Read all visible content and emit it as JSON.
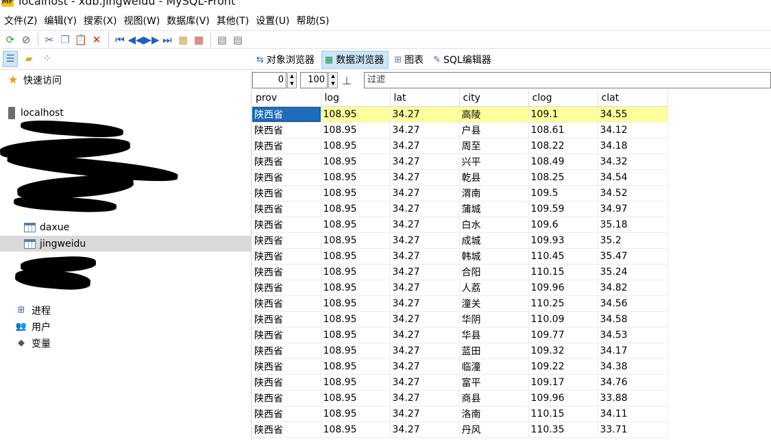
{
  "window": {
    "logo": "MF",
    "title": "localhost - xdb.jingweidu - MySQL-Front"
  },
  "menu": [
    "文件(Z)",
    "编辑(Y)",
    "搜索(X)",
    "视图(W)",
    "数据库(V)",
    "其他(T)",
    "设置(U)",
    "帮助(S)"
  ],
  "views": {
    "object_browser": "对象浏览器",
    "data_browser": "数据浏览器",
    "diagram": "图表",
    "sql_editor": "SQL编辑器"
  },
  "tree": {
    "quick_access": "快速访问",
    "host": "localhost",
    "tables": [
      "daxue",
      "jingweidu"
    ],
    "processes": "进程",
    "users": "用户",
    "variables": "变量"
  },
  "filter": {
    "offset": "0",
    "limit": "100",
    "placeholder": "过滤"
  },
  "grid": {
    "columns": [
      "prov",
      "log",
      "lat",
      "city",
      "clog",
      "clat"
    ],
    "rows": [
      [
        "陕西省",
        "108.95",
        "34.27",
        "高陵",
        "109.1",
        "34.55"
      ],
      [
        "陕西省",
        "108.95",
        "34.27",
        "户县",
        "108.61",
        "34.12"
      ],
      [
        "陕西省",
        "108.95",
        "34.27",
        "周至",
        "108.22",
        "34.18"
      ],
      [
        "陕西省",
        "108.95",
        "34.27",
        "兴平",
        "108.49",
        "34.32"
      ],
      [
        "陕西省",
        "108.95",
        "34.27",
        "乾县",
        "108.25",
        "34.54"
      ],
      [
        "陕西省",
        "108.95",
        "34.27",
        "渭南",
        "109.5",
        "34.52"
      ],
      [
        "陕西省",
        "108.95",
        "34.27",
        "蒲城",
        "109.59",
        "34.97"
      ],
      [
        "陕西省",
        "108.95",
        "34.27",
        "白水",
        "109.6",
        "35.18"
      ],
      [
        "陕西省",
        "108.95",
        "34.27",
        "成城",
        "109.93",
        "35.2"
      ],
      [
        "陕西省",
        "108.95",
        "34.27",
        "韩城",
        "110.45",
        "35.47"
      ],
      [
        "陕西省",
        "108.95",
        "34.27",
        "合阳",
        "110.15",
        "35.24"
      ],
      [
        "陕西省",
        "108.95",
        "34.27",
        "人荔",
        "109.96",
        "34.82"
      ],
      [
        "陕西省",
        "108.95",
        "34.27",
        "潼关",
        "110.25",
        "34.56"
      ],
      [
        "陕西省",
        "108.95",
        "34.27",
        "华阴",
        "110.09",
        "34.58"
      ],
      [
        "陕西省",
        "108.95",
        "34.27",
        "华县",
        "109.77",
        "34.53"
      ],
      [
        "陕西省",
        "108.95",
        "34.27",
        "蓝田",
        "109.32",
        "34.17"
      ],
      [
        "陕西省",
        "108.95",
        "34.27",
        "临潼",
        "109.22",
        "34.38"
      ],
      [
        "陕西省",
        "108.95",
        "34.27",
        "富平",
        "109.17",
        "34.76"
      ],
      [
        "陕西省",
        "108.95",
        "34.27",
        "商县",
        "109.96",
        "33.88"
      ],
      [
        "陕西省",
        "108.95",
        "34.27",
        "洛南",
        "110.15",
        "34.11"
      ],
      [
        "陕西省",
        "108.95",
        "34.27",
        "丹风",
        "110.35",
        "33.71"
      ]
    ]
  }
}
